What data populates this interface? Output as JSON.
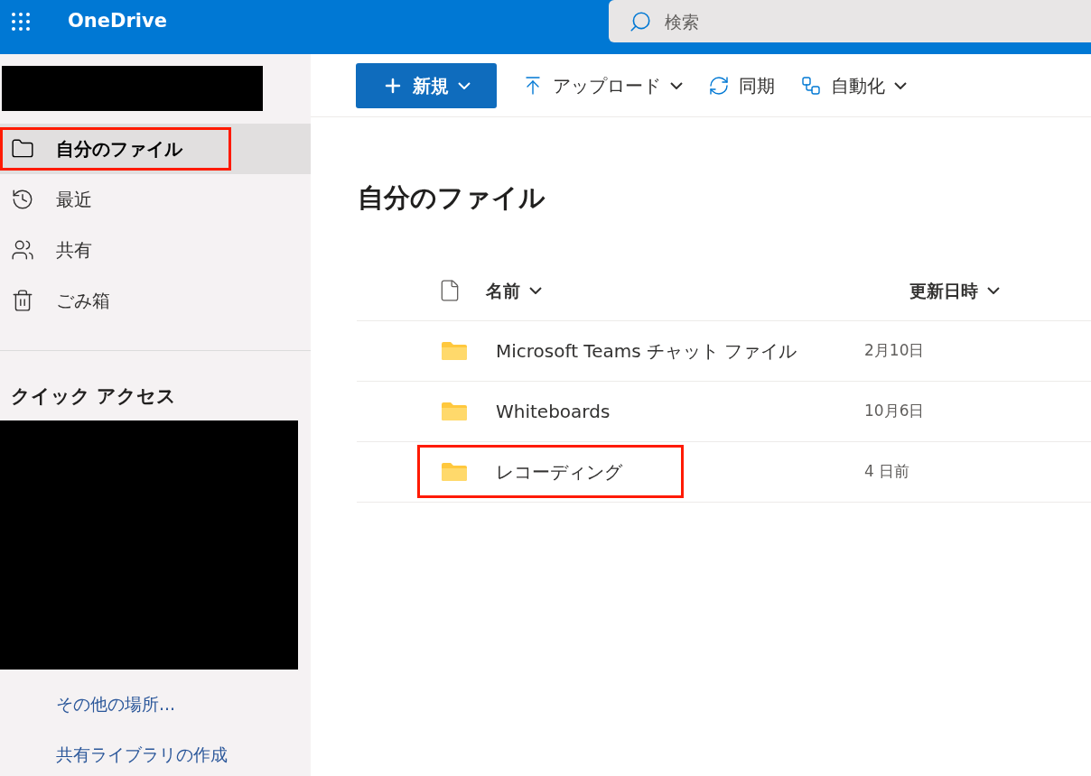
{
  "app_bar": {
    "title": "OneDrive",
    "search": {
      "placeholder": "検索"
    }
  },
  "toolbar": [
    {
      "kind": "primary",
      "label": "新規",
      "dropdown": true
    },
    {
      "kind": "action",
      "label": "アップロード",
      "dropdown": true
    },
    {
      "kind": "action",
      "label": "同期",
      "dropdown": false
    },
    {
      "kind": "action",
      "label": "自動化",
      "dropdown": true
    }
  ],
  "sidebar": {
    "items": [
      {
        "label": "自分のファイル",
        "selected": true,
        "highlighted": true
      },
      {
        "label": "最近",
        "selected": false,
        "highlighted": false
      },
      {
        "label": "共有",
        "selected": false,
        "highlighted": false
      },
      {
        "label": "ごみ箱",
        "selected": false,
        "highlighted": false
      }
    ],
    "quick_access": {
      "title": "クイック アクセス"
    },
    "links": [
      "その他の場所...",
      "共有ライブラリの作成"
    ]
  },
  "main": {
    "heading": "自分のファイル",
    "table": {
      "columns": [
        "名前",
        "更新日時"
      ],
      "rows": [
        {
          "name": "Microsoft Teams チャット ファイル",
          "modified": "2月10日",
          "highlighted": false
        },
        {
          "name": "Whiteboards",
          "modified": "10月6日",
          "highlighted": false
        },
        {
          "name": "レコーディング",
          "modified": "4 日前",
          "highlighted": true
        }
      ]
    }
  }
}
